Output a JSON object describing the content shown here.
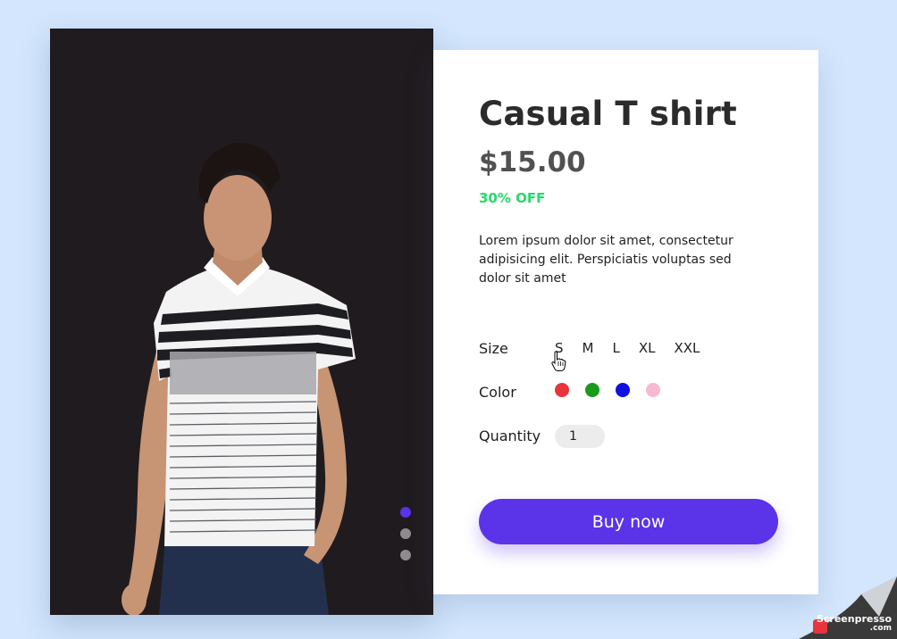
{
  "product": {
    "title": "Casual T shirt",
    "price": "$15.00",
    "discount": "30% OFF",
    "description": "Lorem ipsum dolor sit amet, consectetur adipisicing elit. Perspiciatis voluptas sed dolor sit amet"
  },
  "options": {
    "size_label": "Size",
    "sizes": [
      "S",
      "M",
      "L",
      "XL",
      "XXL"
    ],
    "color_label": "Color",
    "colors": [
      "#e8343b",
      "#1a9a1a",
      "#1010e0",
      "#f7b9d2"
    ],
    "quantity_label": "Quantity",
    "quantity_value": "1"
  },
  "actions": {
    "buy_label": "Buy now"
  },
  "carousel": {
    "count": 3,
    "active_index": 0
  },
  "theme": {
    "accent": "#5b33e8",
    "discount_green": "#28d96a",
    "background": "#d3e6fd"
  },
  "watermark": {
    "line1": "Screenpresso",
    "line2": ".com"
  }
}
